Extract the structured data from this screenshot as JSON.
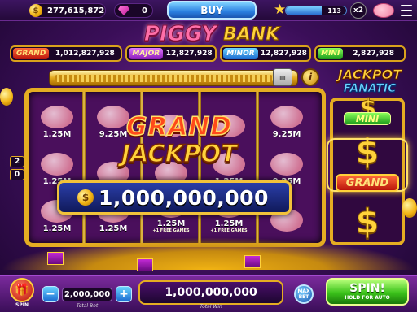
{
  "topbar": {
    "coins": "277,615,872",
    "gems": "0",
    "buy_label": "BUY",
    "level": "113",
    "level_progress": 0.6,
    "multiplier": "x2"
  },
  "logo": {
    "word1": "PIGGY",
    "word2": "BANK"
  },
  "jackpots": [
    {
      "name": "GRAND",
      "value": "1,012,827,928"
    },
    {
      "name": "MAJOR",
      "value": "12,827,928"
    },
    {
      "name": "MINOR",
      "value": "12,827,928"
    },
    {
      "name": "MINI",
      "value": "2,827,928"
    }
  ],
  "reels": {
    "rows_labels": [
      "2",
      "0"
    ],
    "cells": [
      {
        "value": "1.25M",
        "sub": ""
      },
      {
        "value": "9.25M",
        "sub": ""
      },
      {
        "value": "",
        "sub": ""
      },
      {
        "value": "",
        "sub": ""
      },
      {
        "value": "9.25M",
        "sub": ""
      },
      {
        "value": "1.25M",
        "sub": ""
      },
      {
        "value": "",
        "sub": ""
      },
      {
        "value": "",
        "sub": ""
      },
      {
        "value": "1.25M",
        "sub": ""
      },
      {
        "value": "9.25M",
        "sub": ""
      },
      {
        "value": "1.25M",
        "sub": ""
      },
      {
        "value": "1.25M",
        "sub": ""
      },
      {
        "value": "1.25M",
        "sub": "+1 FREE GAMES"
      },
      {
        "value": "1.25M",
        "sub": "+1 FREE GAMES"
      },
      {
        "value": "",
        "sub": ""
      }
    ]
  },
  "grand_jackpot": {
    "line1": "GRAND",
    "line2": "JACKPOT",
    "amount": "1,000,000,000"
  },
  "fanatic": {
    "title1": "JACKPOT",
    "title2": "FANATIC",
    "mini": "MINI",
    "grand": "GRAND",
    "symbol": "$"
  },
  "bottom": {
    "spin_gift_label": "SPIN",
    "bet": "2,000,000",
    "bet_label": "Total Bet",
    "win": "1,000,000,000",
    "win_label": "Total Win",
    "maxbet": "MAX BET",
    "spin": "SPIN!",
    "spin_sub": "HOLD FOR AUTO"
  }
}
